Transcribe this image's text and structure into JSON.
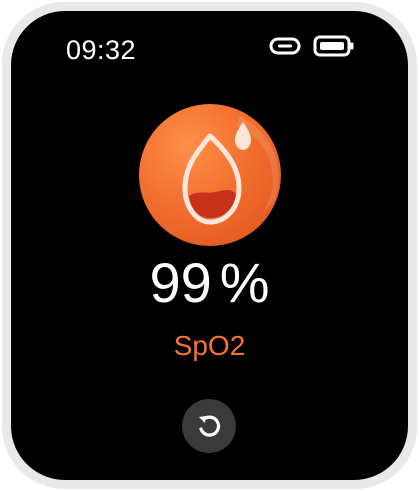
{
  "status_bar": {
    "time": "09:32",
    "icons": [
      "link-icon",
      "battery-icon"
    ]
  },
  "app_icon": {
    "name": "blood-drop-icon"
  },
  "reading": {
    "value": "99",
    "unit": "%",
    "label": "SpO2"
  },
  "actions": {
    "refresh_icon": "refresh-icon"
  },
  "colors": {
    "accent": "#f2752f",
    "screen_bg": "#000000",
    "button_bg": "#3a3a3a",
    "bezel": "#e9e9e9"
  }
}
